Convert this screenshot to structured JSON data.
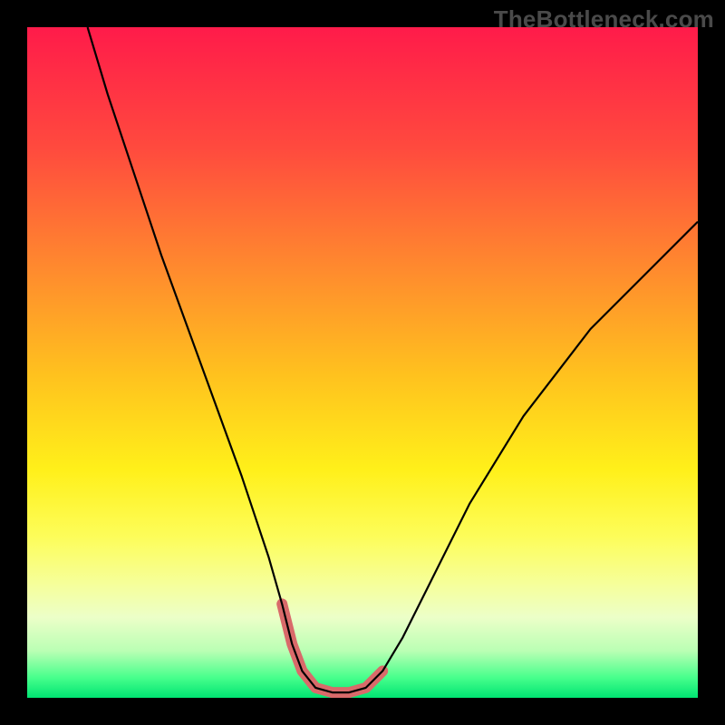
{
  "watermark": "TheBottleneck.com",
  "chart_data": {
    "type": "line",
    "title": "",
    "xlabel": "",
    "ylabel": "",
    "xlim": [
      0,
      100
    ],
    "ylim": [
      0,
      100
    ],
    "series": [
      {
        "name": "curve",
        "color": "#000000",
        "width": 2.2,
        "x": [
          9,
          12,
          16,
          20,
          24,
          28,
          32,
          34,
          36,
          38,
          39.5,
          41,
          43,
          45.5,
          48,
          50.5,
          53,
          56,
          60,
          66,
          74,
          84,
          94,
          100
        ],
        "y_pct": [
          100,
          90,
          78,
          66,
          55,
          44,
          33,
          27,
          21,
          14,
          8,
          4,
          1.5,
          0.8,
          0.8,
          1.5,
          4,
          9,
          17,
          29,
          42,
          55,
          65,
          71
        ]
      },
      {
        "name": "highlight",
        "color": "#d96a6a",
        "width": 12,
        "cap": "round",
        "x": [
          38,
          39.5,
          41,
          43,
          45.5,
          48,
          50.5,
          53
        ],
        "y_pct": [
          14,
          8,
          4,
          1.5,
          0.8,
          0.8,
          1.5,
          4
        ]
      }
    ],
    "gradient_stops": [
      {
        "pos": 0,
        "color": "#ff1b4a"
      },
      {
        "pos": 18,
        "color": "#ff4a3e"
      },
      {
        "pos": 36,
        "color": "#ff8a2e"
      },
      {
        "pos": 52,
        "color": "#ffc21e"
      },
      {
        "pos": 66,
        "color": "#fff01a"
      },
      {
        "pos": 76,
        "color": "#fdfd5a"
      },
      {
        "pos": 83,
        "color": "#f6ff9a"
      },
      {
        "pos": 88,
        "color": "#ecffc8"
      },
      {
        "pos": 93,
        "color": "#baffb4"
      },
      {
        "pos": 97,
        "color": "#47ff8c"
      },
      {
        "pos": 100,
        "color": "#00e472"
      }
    ]
  }
}
